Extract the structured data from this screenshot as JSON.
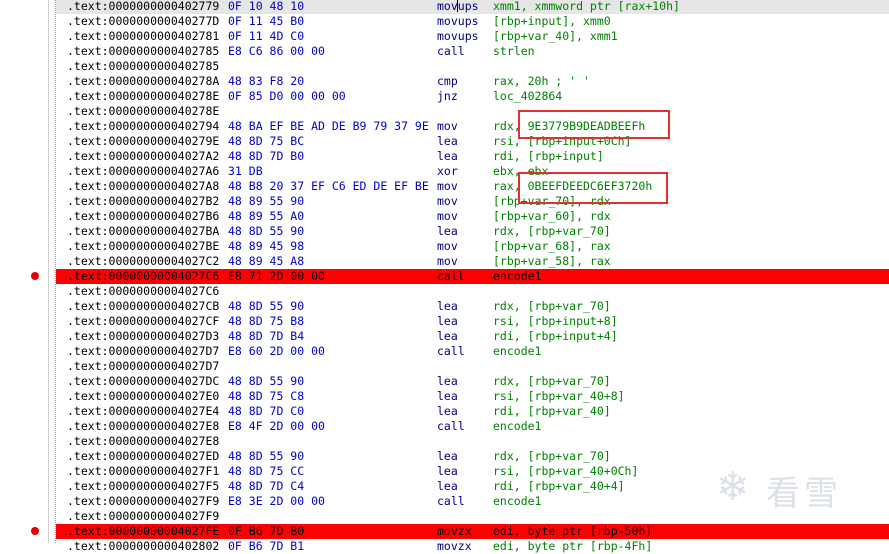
{
  "listing": [
    {
      "addr": ".text:0000000000402779",
      "bytes": "0F 10 48 10",
      "mnem": "movups",
      "ops": "xmm1, xmmword ptr [rax+10h]",
      "state": "selected"
    },
    {
      "addr": ".text:000000000040277D",
      "bytes": "0F 11 45 B0",
      "mnem": "movups",
      "ops": "[rbp+input], xmm0",
      "state": ""
    },
    {
      "addr": ".text:0000000000402781",
      "bytes": "0F 11 4D C0",
      "mnem": "movups",
      "ops": "[rbp+var_40], xmm1",
      "state": ""
    },
    {
      "addr": ".text:0000000000402785",
      "bytes": "E8 C6 86 00 00",
      "mnem": "call",
      "ops": "strlen",
      "state": ""
    },
    {
      "addr": ".text:0000000000402785",
      "bytes": "",
      "mnem": "",
      "ops": "",
      "state": ""
    },
    {
      "addr": ".text:000000000040278A",
      "bytes": "48 83 F8 20",
      "mnem": "cmp",
      "ops": "rax, 20h ; ' '",
      "state": ""
    },
    {
      "addr": ".text:000000000040278E",
      "bytes": "0F 85 D0 00 00 00",
      "mnem": "jnz",
      "ops": "loc_402864",
      "state": ""
    },
    {
      "addr": ".text:000000000040278E",
      "bytes": "",
      "mnem": "",
      "ops": "",
      "state": ""
    },
    {
      "addr": ".text:0000000000402794",
      "bytes": "48 BA EF BE AD DE B9 79 37 9E",
      "mnem": "mov",
      "ops": "rdx, 9E3779B9DEADBEEFh",
      "state": ""
    },
    {
      "addr": ".text:000000000040279E",
      "bytes": "48 8D 75 BC",
      "mnem": "lea",
      "ops": "rsi, [rbp+input+0Ch]",
      "state": ""
    },
    {
      "addr": ".text:00000000004027A2",
      "bytes": "48 8D 7D B0",
      "mnem": "lea",
      "ops": "rdi, [rbp+input]",
      "state": ""
    },
    {
      "addr": ".text:00000000004027A6",
      "bytes": "31 DB",
      "mnem": "xor",
      "ops": "ebx, ebx",
      "state": ""
    },
    {
      "addr": ".text:00000000004027A8",
      "bytes": "48 B8 20 37 EF C6 ED DE EF BE",
      "mnem": "mov",
      "ops": "rax, 0BEEFDEEDC6EF3720h",
      "state": ""
    },
    {
      "addr": ".text:00000000004027B2",
      "bytes": "48 89 55 90",
      "mnem": "mov",
      "ops": "[rbp+var_70], rdx",
      "state": ""
    },
    {
      "addr": ".text:00000000004027B6",
      "bytes": "48 89 55 A0",
      "mnem": "mov",
      "ops": "[rbp+var_60], rdx",
      "state": ""
    },
    {
      "addr": ".text:00000000004027BA",
      "bytes": "48 8D 55 90",
      "mnem": "lea",
      "ops": "rdx, [rbp+var_70]",
      "state": ""
    },
    {
      "addr": ".text:00000000004027BE",
      "bytes": "48 89 45 98",
      "mnem": "mov",
      "ops": "[rbp+var_68], rax",
      "state": ""
    },
    {
      "addr": ".text:00000000004027C2",
      "bytes": "48 89 45 A8",
      "mnem": "mov",
      "ops": "[rbp+var_58], rax",
      "state": ""
    },
    {
      "addr": ".text:00000000004027C6",
      "bytes": "E8 71 2D 00 00",
      "mnem": "call",
      "ops": "encode1",
      "state": "breakpoint"
    },
    {
      "addr": ".text:00000000004027C6",
      "bytes": "",
      "mnem": "",
      "ops": "",
      "state": ""
    },
    {
      "addr": ".text:00000000004027CB",
      "bytes": "48 8D 55 90",
      "mnem": "lea",
      "ops": "rdx, [rbp+var_70]",
      "state": ""
    },
    {
      "addr": ".text:00000000004027CF",
      "bytes": "48 8D 75 B8",
      "mnem": "lea",
      "ops": "rsi, [rbp+input+8]",
      "state": ""
    },
    {
      "addr": ".text:00000000004027D3",
      "bytes": "48 8D 7D B4",
      "mnem": "lea",
      "ops": "rdi, [rbp+input+4]",
      "state": ""
    },
    {
      "addr": ".text:00000000004027D7",
      "bytes": "E8 60 2D 00 00",
      "mnem": "call",
      "ops": "encode1",
      "state": ""
    },
    {
      "addr": ".text:00000000004027D7",
      "bytes": "",
      "mnem": "",
      "ops": "",
      "state": ""
    },
    {
      "addr": ".text:00000000004027DC",
      "bytes": "48 8D 55 90",
      "mnem": "lea",
      "ops": "rdx, [rbp+var_70]",
      "state": ""
    },
    {
      "addr": ".text:00000000004027E0",
      "bytes": "48 8D 75 C8",
      "mnem": "lea",
      "ops": "rsi, [rbp+var_40+8]",
      "state": ""
    },
    {
      "addr": ".text:00000000004027E4",
      "bytes": "48 8D 7D C0",
      "mnem": "lea",
      "ops": "rdi, [rbp+var_40]",
      "state": ""
    },
    {
      "addr": ".text:00000000004027E8",
      "bytes": "E8 4F 2D 00 00",
      "mnem": "call",
      "ops": "encode1",
      "state": ""
    },
    {
      "addr": ".text:00000000004027E8",
      "bytes": "",
      "mnem": "",
      "ops": "",
      "state": ""
    },
    {
      "addr": ".text:00000000004027ED",
      "bytes": "48 8D 55 90",
      "mnem": "lea",
      "ops": "rdx, [rbp+var_70]",
      "state": ""
    },
    {
      "addr": ".text:00000000004027F1",
      "bytes": "48 8D 75 CC",
      "mnem": "lea",
      "ops": "rsi, [rbp+var_40+0Ch]",
      "state": ""
    },
    {
      "addr": ".text:00000000004027F5",
      "bytes": "48 8D 7D C4",
      "mnem": "lea",
      "ops": "rdi, [rbp+var_40+4]",
      "state": ""
    },
    {
      "addr": ".text:00000000004027F9",
      "bytes": "E8 3E 2D 00 00",
      "mnem": "call",
      "ops": "encode1",
      "state": ""
    },
    {
      "addr": ".text:00000000004027F9",
      "bytes": "",
      "mnem": "",
      "ops": "",
      "state": ""
    },
    {
      "addr": ".text:00000000004027FE",
      "bytes": "0F B6 7D B0",
      "mnem": "movzx",
      "ops": "edi, byte ptr [rbp-50h]",
      "state": "breakpoint"
    },
    {
      "addr": ".text:0000000000402802",
      "bytes": "0F B6 7D B1",
      "mnem": "movzx",
      "ops": "edi, byte ptr [rbp-4Fh]",
      "state": ""
    }
  ],
  "colors": {
    "address": "#000000",
    "bytes": "#0000c8",
    "mnemonic": "#000080",
    "operand": "#008000",
    "breakpoint_row": "#ff0000",
    "selected_row": "#e6e6e6",
    "annotation_box": "#e03030"
  },
  "watermark": {
    "icon": "snowflake-icon",
    "text": "看雪"
  }
}
